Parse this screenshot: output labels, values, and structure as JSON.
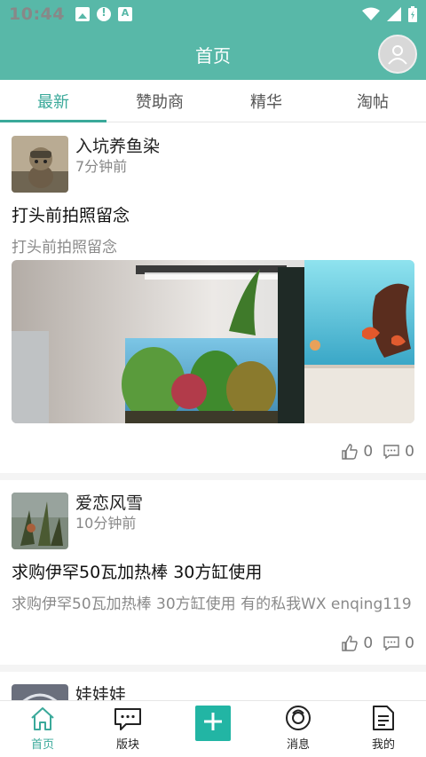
{
  "status_bar": {
    "time": "10:44"
  },
  "app_bar": {
    "title": "首页"
  },
  "tabs": [
    {
      "label": "最新",
      "active": true
    },
    {
      "label": "赞助商",
      "active": false
    },
    {
      "label": "精华",
      "active": false
    },
    {
      "label": "淘帖",
      "active": false
    }
  ],
  "posts": [
    {
      "author": "入坑养鱼染",
      "time": "7分钟前",
      "title": "打头前拍照留念",
      "body": "打头前拍照留念",
      "likes": "0",
      "comments": "0"
    },
    {
      "author": "爱恋风雪",
      "time": "10分钟前",
      "title": "求购伊罕50瓦加热棒 30方缸使用",
      "body": "求购伊罕50瓦加热棒 30方缸使用   有的私我WX enqing119",
      "likes": "0",
      "comments": "0"
    },
    {
      "author": "娃娃娃"
    }
  ],
  "bottom_nav": [
    {
      "label": "首页",
      "icon": "home-icon",
      "active": true
    },
    {
      "label": "版块",
      "icon": "chat-icon",
      "active": false
    },
    {
      "label": "",
      "icon": "add-icon",
      "active": false
    },
    {
      "label": "消息",
      "icon": "message-icon",
      "active": false
    },
    {
      "label": "我的",
      "icon": "document-icon",
      "active": false
    }
  ],
  "colors": {
    "primary": "#58b8a8",
    "accent": "#3aa99a",
    "add_button": "#22b5a4"
  }
}
